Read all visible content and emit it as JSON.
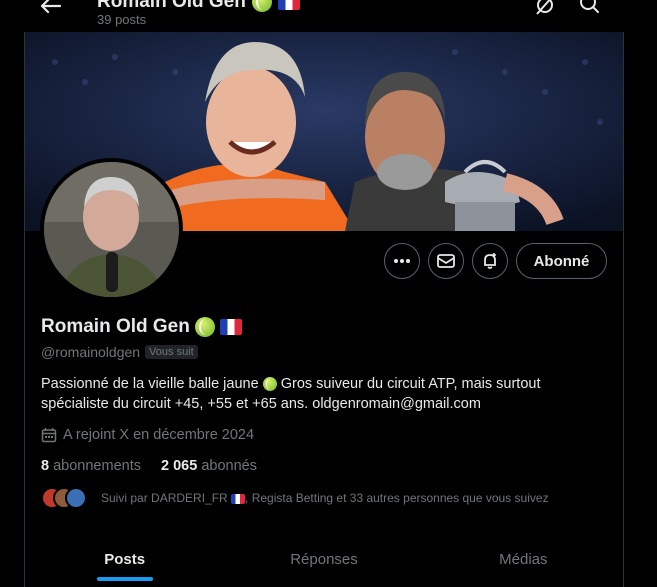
{
  "header": {
    "title": "Romain Old Gen",
    "posts_count": "39 posts"
  },
  "profile": {
    "name": "Romain Old Gen",
    "handle": "@romainoldgen",
    "follows_you_badge": "Vous suit",
    "bio_text": "Passionné de la vieille balle jaune",
    "bio_text_2": "Gros suiveur du circuit ATP, mais surtout",
    "bio_text_3": "spécialiste du circuit +45, +55 et +65 ans.",
    "bio_email": "oldgenromain@gmail.com",
    "joined": "A rejoint X en décembre 2024",
    "following_count": "8",
    "following_label": "abonnements",
    "followers_count": "2 065",
    "followers_label": "abonnés",
    "followed_by": "Suivi par DARDERI_FR",
    "followed_by_rest": ", Regista Betting et 33 autres personnes que vous suivez"
  },
  "actions": {
    "more_icon": "more-icon",
    "message_icon": "mail-icon",
    "notify_icon": "bell-plus-icon",
    "follow_label": "Abonné"
  },
  "tabs": [
    {
      "label": "Posts",
      "active": true
    },
    {
      "label": "Réponses",
      "active": false
    },
    {
      "label": "Médias",
      "active": false
    }
  ],
  "colors": {
    "accent": "#1d9bf0",
    "background": "#000000",
    "muted": "#71767b"
  }
}
